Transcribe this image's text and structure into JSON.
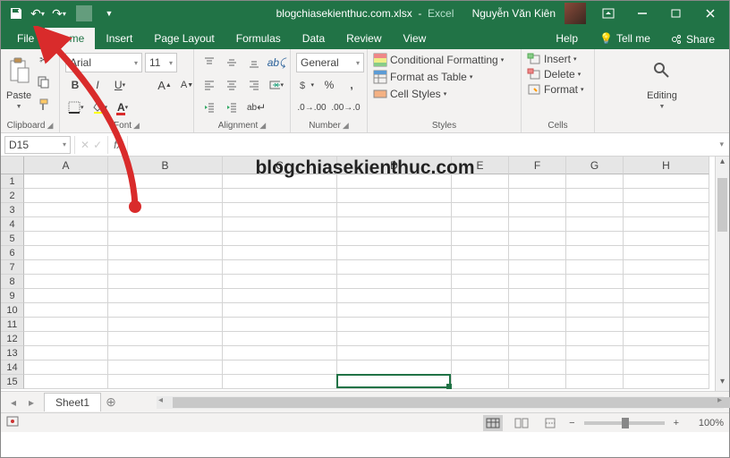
{
  "titlebar": {
    "filename": "blogchiasekienthuc.com.xlsx",
    "app": "Excel",
    "user": "Nguyễn Văn Kiên"
  },
  "tabs": {
    "file": "File",
    "home": "Home",
    "insert": "Insert",
    "pagelayout": "Page Layout",
    "formulas": "Formulas",
    "data": "Data",
    "review": "Review",
    "view": "View",
    "help": "Help",
    "tellme": "Tell me",
    "share": "Share"
  },
  "ribbon": {
    "clipboard": {
      "label": "Clipboard",
      "paste": "Paste"
    },
    "font": {
      "label": "Font",
      "name": "Arial",
      "size": "11",
      "bold": "B",
      "italic": "I",
      "underline": "U"
    },
    "alignment": {
      "label": "Alignment",
      "wrap": "ab"
    },
    "number": {
      "label": "Number",
      "format": "General"
    },
    "styles": {
      "label": "Styles",
      "conditional": "Conditional Formatting",
      "table": "Format as Table",
      "cell": "Cell Styles"
    },
    "cells": {
      "label": "Cells",
      "insert": "Insert",
      "delete": "Delete",
      "format": "Format"
    },
    "editing": {
      "label": "Editing"
    }
  },
  "formulabar": {
    "namebox": "D15",
    "fx": "fx"
  },
  "grid": {
    "cols": [
      "A",
      "B",
      "C",
      "D",
      "E",
      "F",
      "G",
      "H"
    ],
    "rows": [
      "1",
      "2",
      "3",
      "4",
      "5",
      "6",
      "7",
      "8",
      "9",
      "10",
      "11",
      "12",
      "13",
      "14",
      "15"
    ],
    "selected": "D15"
  },
  "sheets": {
    "sheet1": "Sheet1"
  },
  "status": {
    "zoom": "100%"
  },
  "watermark": "blogchiasekienthuc.com"
}
